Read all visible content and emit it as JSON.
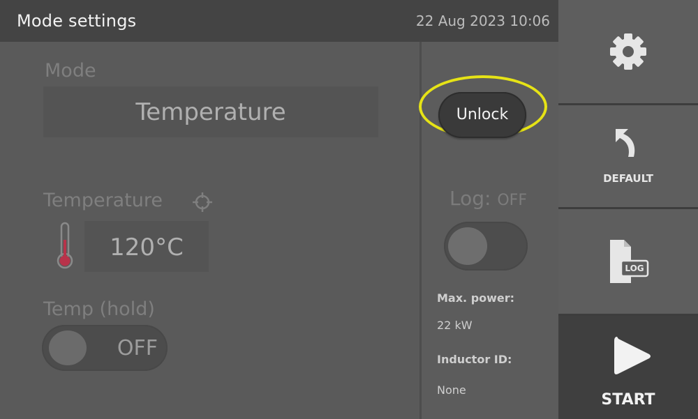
{
  "header": {
    "title": "Mode settings",
    "datetime": "22 Aug 2023 10:06"
  },
  "main": {
    "mode_label": "Mode",
    "mode_value": "Temperature",
    "temperature_label": "Temperature",
    "temperature_value": "120°C",
    "hold_label": "Temp (hold)",
    "hold_state": "OFF"
  },
  "right_panel": {
    "unlock_label": "Unlock",
    "log_label": "Log:",
    "log_state": "OFF",
    "max_power_label": "Max. power:",
    "max_power_value": "22 kW",
    "inductor_label": "Inductor ID:",
    "inductor_value": "None"
  },
  "sidebar": {
    "settings_icon": "gear-icon",
    "default_label": "DEFAULT",
    "default_icon": "undo-arrow-icon",
    "log_icon": "log-file-icon",
    "log_icon_text": "LOG",
    "start_label": "START",
    "start_icon": "play-icon"
  },
  "colors": {
    "highlight_ring": "#e6e316",
    "thermometer_fill": "#b8334a"
  }
}
